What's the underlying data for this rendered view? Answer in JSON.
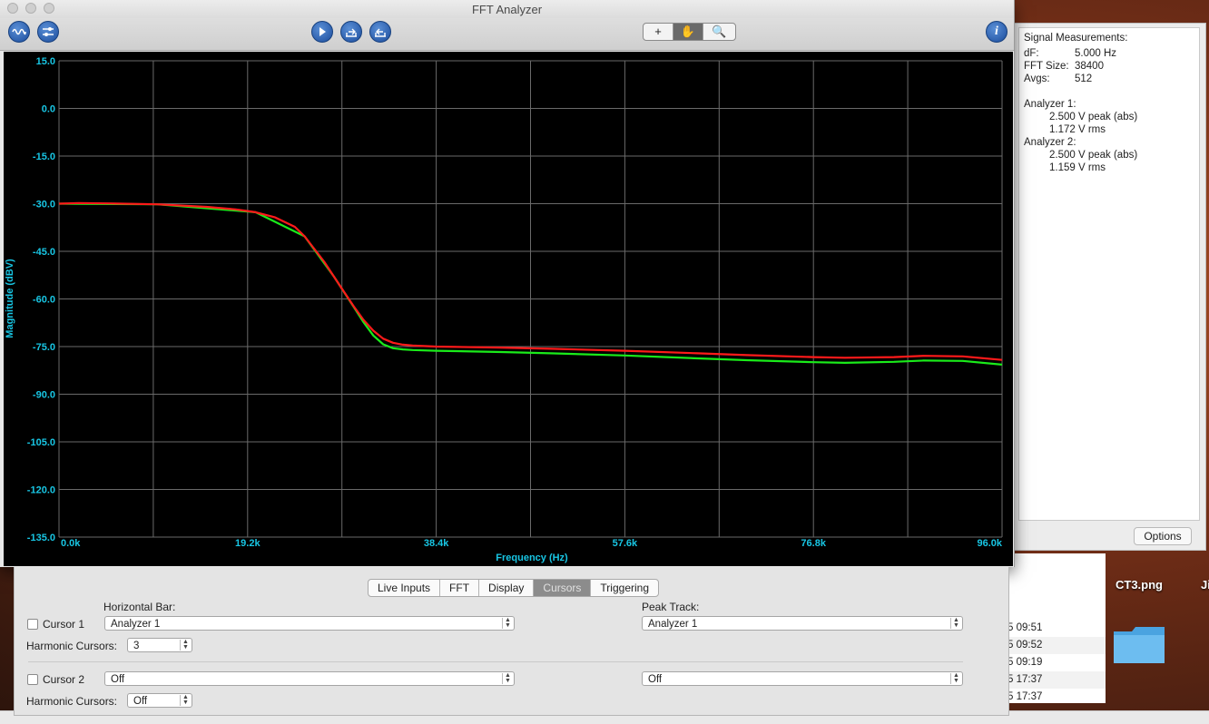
{
  "window": {
    "title": "FFT Analyzer"
  },
  "toolbar": {
    "tools": [
      "+",
      "✋",
      "🔍"
    ],
    "active_tool": 1,
    "info": "i"
  },
  "measurements": {
    "heading": "Signal Measurements:",
    "df_label": "dF:",
    "df_value": "5.000 Hz",
    "fft_label": "FFT Size:",
    "fft_value": "38400",
    "avgs_label": "Avgs:",
    "avgs_value": "512",
    "a1_label": "Analyzer 1:",
    "a1_peak": "2.500 V peak (abs)",
    "a1_rms": "1.172 V rms",
    "a2_label": "Analyzer 2:",
    "a2_peak": "2.500 V peak (abs)",
    "a2_rms": "1.159 V rms",
    "options_label": "Options"
  },
  "chart_data": {
    "type": "line",
    "xlabel": "Frequency (Hz)",
    "ylabel": "Magnitude (dBV)",
    "xlim": [
      0,
      96000
    ],
    "ylim": [
      -135,
      15
    ],
    "x_ticks": [
      "0.0k",
      "19.2k",
      "38.4k",
      "57.6k",
      "76.8k",
      "96.0k"
    ],
    "y_ticks": [
      "15.0",
      "0.0",
      "-15.0",
      "-30.0",
      "-45.0",
      "-60.0",
      "-75.0",
      "-90.0",
      "-105.0",
      "-120.0",
      "-135.0"
    ],
    "grid": true,
    "colors": {
      "background": "#000000",
      "grid": "#6a6a6a",
      "tick": "#18c6e4"
    },
    "series": [
      {
        "color": "#ff1a1a",
        "x": [
          0,
          2000,
          5000,
          10000,
          15000,
          18000,
          20000,
          22000,
          24000,
          25000,
          26000,
          27000,
          28000,
          29000,
          30000,
          31000,
          32000,
          33000,
          34000,
          35000,
          36000,
          38400,
          45000,
          50000,
          57600,
          65000,
          70000,
          76800,
          80000,
          85000,
          88000,
          92000,
          96000
        ],
        "y": [
          -30.0,
          -29.8,
          -29.9,
          -30.2,
          -31.0,
          -31.8,
          -32.7,
          -34.3,
          -37.3,
          -40.3,
          -44.3,
          -48.3,
          -53.0,
          -57.7,
          -62.3,
          -66.6,
          -70.0,
          -72.5,
          -73.8,
          -74.4,
          -74.7,
          -75.0,
          -75.3,
          -75.7,
          -76.3,
          -77.1,
          -77.7,
          -78.3,
          -78.5,
          -78.3,
          -77.9,
          -78.1,
          -79.2
        ]
      },
      {
        "color": "#1aeb1a",
        "x": [
          0,
          10000,
          20000,
          25000,
          28000,
          30000,
          31000,
          32000,
          33000,
          34000,
          35000,
          36000,
          38400,
          45000,
          50000,
          57600,
          65000,
          70000,
          76800,
          80000,
          85000,
          88000,
          92000,
          96000
        ],
        "y": [
          -30.0,
          -30.2,
          -32.7,
          -40.3,
          -53.0,
          -62.5,
          -67.3,
          -71.5,
          -74.3,
          -75.5,
          -75.9,
          -76.1,
          -76.3,
          -76.7,
          -77.1,
          -77.8,
          -78.7,
          -79.3,
          -79.9,
          -80.1,
          -79.8,
          -79.4,
          -79.5,
          -80.7
        ]
      }
    ]
  },
  "controls": {
    "tabs": [
      "Live Inputs",
      "FFT",
      "Display",
      "Cursors",
      "Triggering"
    ],
    "active_tab": 3,
    "horizontal_bar_label": "Horizontal Bar:",
    "peak_track_label": "Peak Track:",
    "cursor1_label": "Cursor 1",
    "cursor1_hbar": "Analyzer 1",
    "cursor1_peak": "Analyzer 1",
    "harmonic_label": "Harmonic Cursors:",
    "harmonic1_value": "3",
    "cursor2_label": "Cursor 2",
    "cursor2_hbar": "Off",
    "cursor2_peak": "Off",
    "harmonic2_value": "Off"
  },
  "desktop": {
    "icon_label": "CT3.png",
    "icon_label2": "Ji",
    "finder_rows": [
      "5 09:51",
      "5 09:52",
      "5 09:19",
      "5 17:37",
      "5 17:37"
    ]
  }
}
